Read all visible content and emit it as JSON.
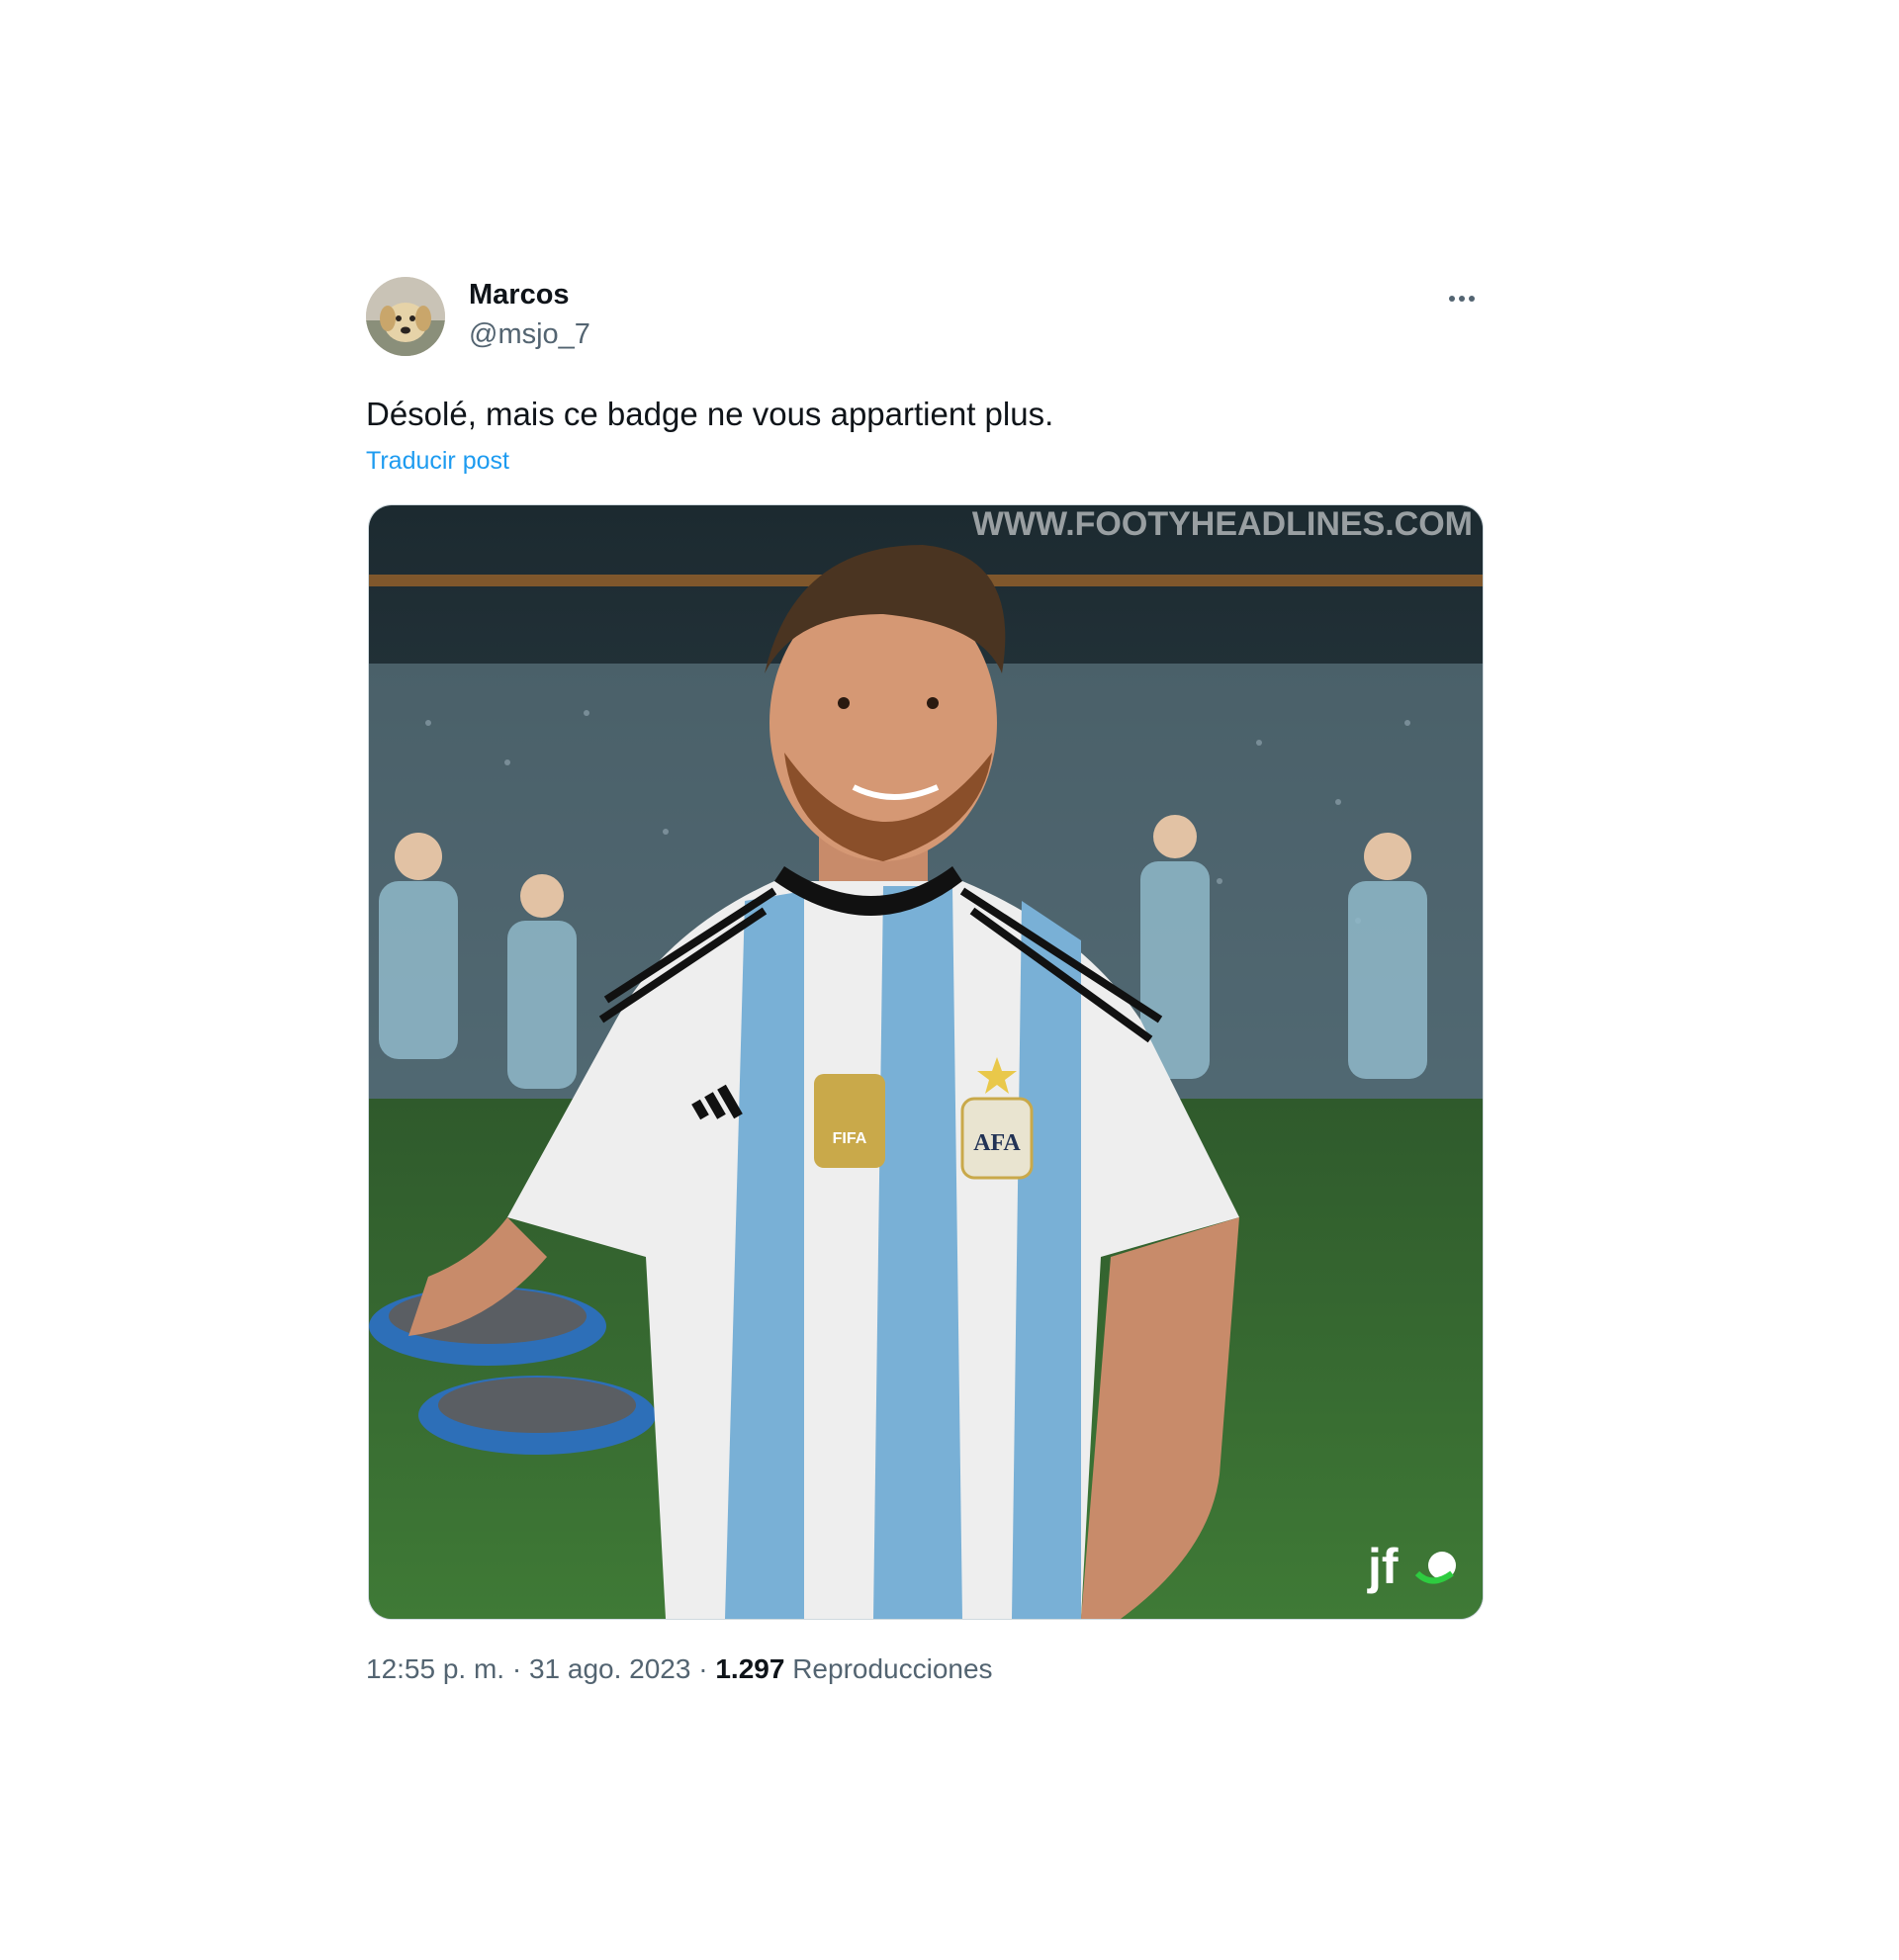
{
  "post": {
    "author_name": "Marcos",
    "author_handle": "@msjo_7",
    "text": "Désolé, mais ce badge ne vous appartient plus.",
    "translate_label": "Traducir post",
    "timestamp": "12:55 p. m. · 31 ago. 2023 · ",
    "views_count": "1.297",
    "views_label": " Reproducciones"
  },
  "media": {
    "watermark": "WWW.FOOTYHEADLINES.COM",
    "corner_logo": "jf",
    "badge_text": "FIFA",
    "crest_text": "AFA"
  },
  "icons": {
    "more": "more-horizontal-icon"
  }
}
